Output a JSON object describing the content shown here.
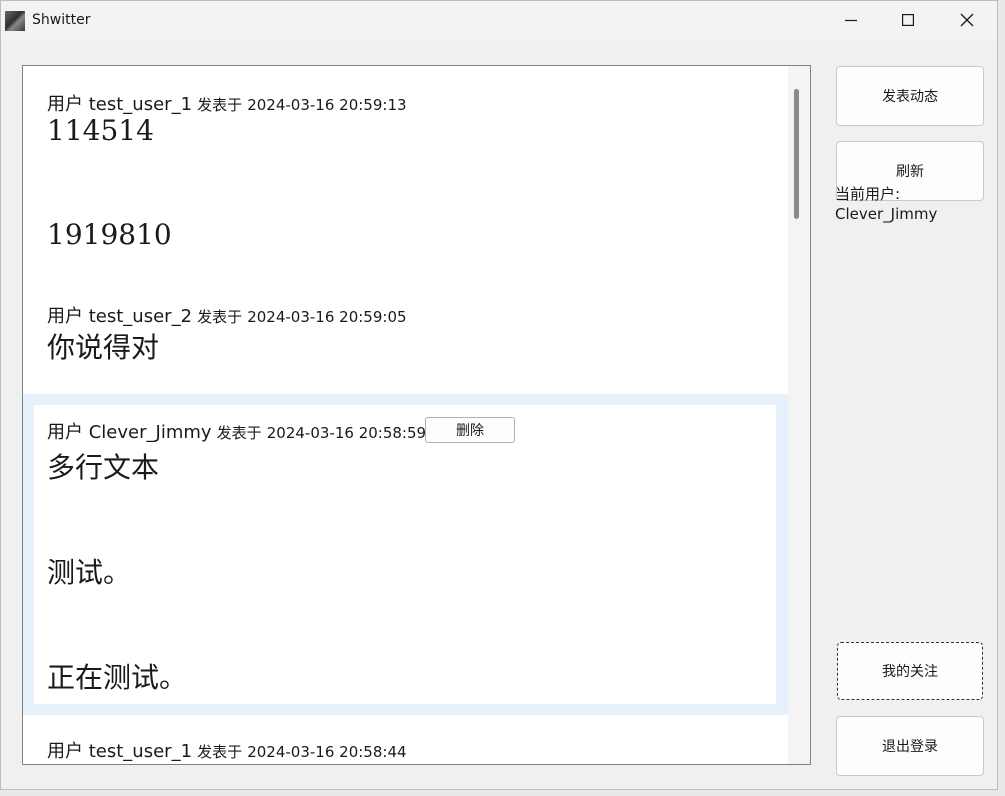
{
  "window": {
    "title": "Shwitter"
  },
  "feed": {
    "posts": [
      {
        "prefix": "用户 ",
        "username": "test_user_1",
        "posted_label": "发表于",
        "timestamp": "2024-03-16 20:59:13",
        "lines": [
          "114514",
          "",
          "1919810"
        ]
      },
      {
        "prefix": "用户 ",
        "username": "test_user_2",
        "posted_label": "发表于",
        "timestamp": "2024-03-16 20:59:05",
        "lines": [
          "你说得对"
        ]
      },
      {
        "prefix": "用户 ",
        "username": "Clever_Jimmy",
        "posted_label": "发表于",
        "timestamp": "2024-03-16 20:58:59",
        "delete_label": "删除",
        "lines": [
          "多行文本",
          "",
          "测试。",
          "",
          "正在测试。"
        ]
      },
      {
        "prefix": "用户 ",
        "username": "test_user_1",
        "posted_label": "发表于",
        "timestamp": "2024-03-16 20:58:44",
        "lines": []
      }
    ]
  },
  "sidebar": {
    "post_button": "发表动态",
    "refresh_button": "刷新",
    "current_user_label": "当前用户:",
    "current_user": "Clever_Jimmy",
    "following_button": "我的关注",
    "logout_button": "退出登录"
  }
}
